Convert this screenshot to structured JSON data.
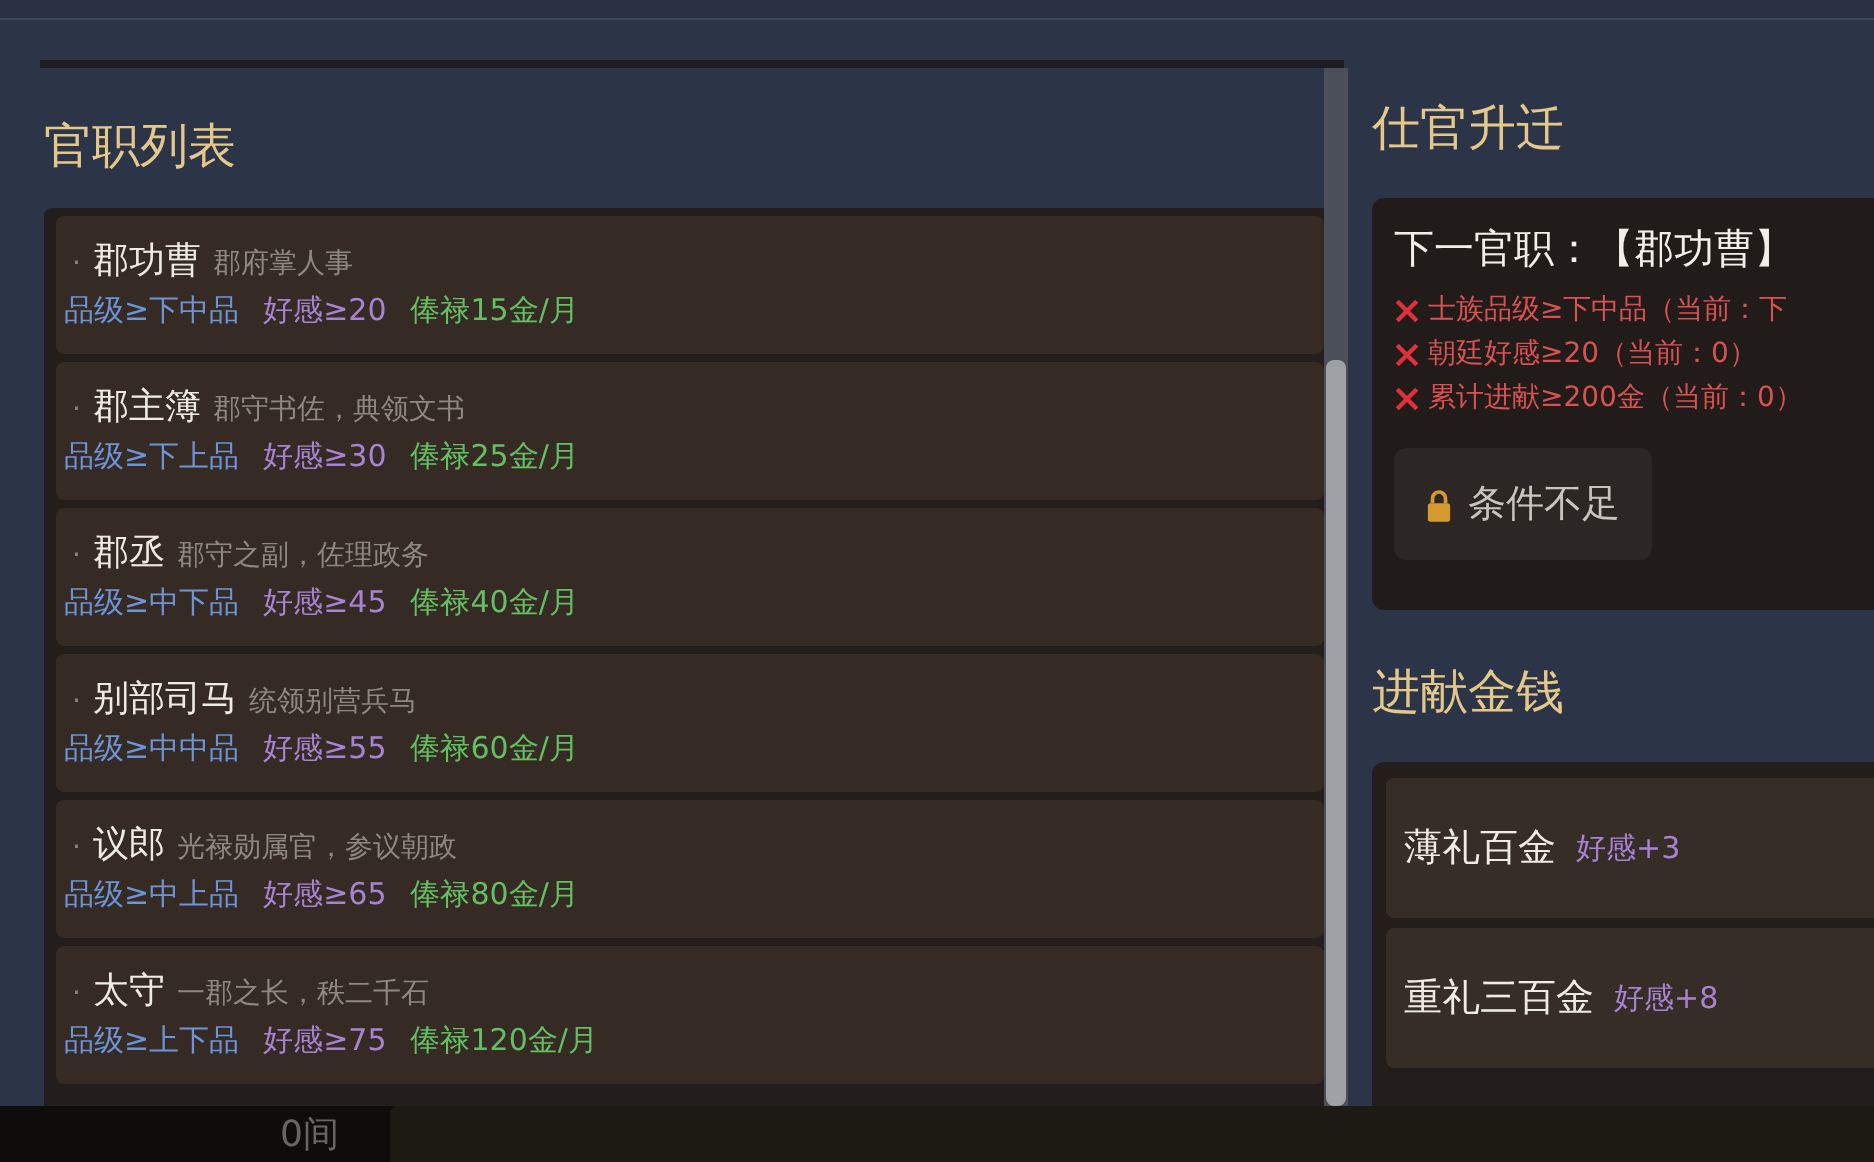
{
  "office_list": {
    "title": "官职列表",
    "rows": [
      {
        "marker": "·",
        "name": "郡功曹",
        "desc": "郡府掌人事",
        "rank": "品级≥下中品",
        "favor": "好感≥20",
        "salary": "俸禄15金/月"
      },
      {
        "marker": "·",
        "name": "郡主簿",
        "desc": "郡守书佐，典领文书",
        "rank": "品级≥下上品",
        "favor": "好感≥30",
        "salary": "俸禄25金/月"
      },
      {
        "marker": "·",
        "name": "郡丞",
        "desc": "郡守之副，佐理政务",
        "rank": "品级≥中下品",
        "favor": "好感≥45",
        "salary": "俸禄40金/月"
      },
      {
        "marker": "·",
        "name": "别部司马",
        "desc": "统领别营兵马",
        "rank": "品级≥中中品",
        "favor": "好感≥55",
        "salary": "俸禄60金/月"
      },
      {
        "marker": "·",
        "name": "议郎",
        "desc": "光禄勋属官，参议朝政",
        "rank": "品级≥中上品",
        "favor": "好感≥65",
        "salary": "俸禄80金/月"
      },
      {
        "marker": "·",
        "name": "太守",
        "desc": "一郡之长，秩二千石",
        "rank": "品级≥上下品",
        "favor": "好感≥75",
        "salary": "俸禄120金/月"
      }
    ]
  },
  "promotion": {
    "title": "仕官升迁",
    "next": "下一官职：【郡功曹】",
    "conditions": [
      {
        "text": "士族品级≥下中品（当前：下",
        "met": false
      },
      {
        "text": "朝廷好感≥20（当前：0）",
        "met": false
      },
      {
        "text": "累计进献≥200金（当前：0）",
        "met": false
      }
    ],
    "button": {
      "label": "条件不足",
      "disabled": true
    }
  },
  "donation": {
    "title": "进献金钱",
    "items": [
      {
        "name": "薄礼百金",
        "effect": "好感+3"
      },
      {
        "name": "重礼三百金",
        "effect": "好感+8"
      }
    ]
  },
  "footer": {
    "text": "0间"
  }
}
